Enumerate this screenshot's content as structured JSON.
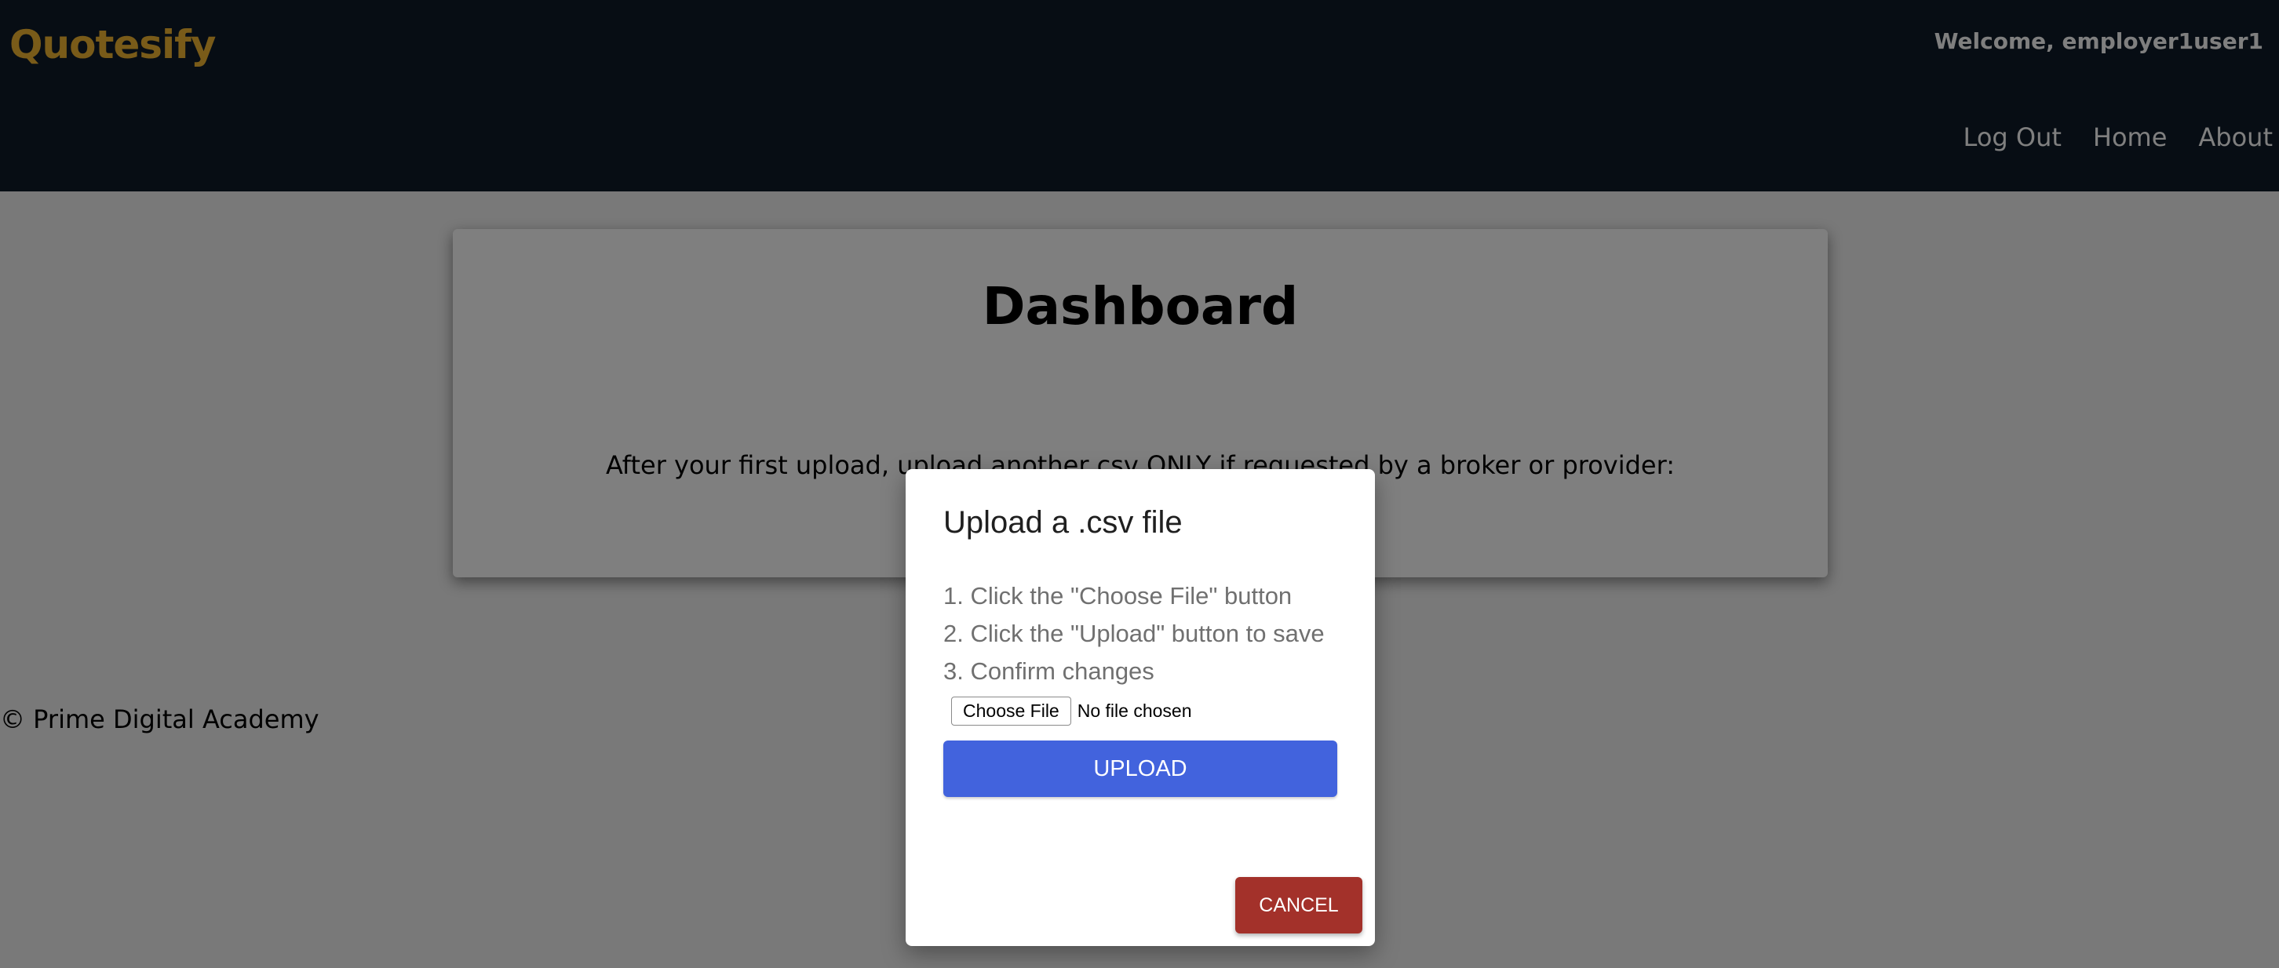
{
  "header": {
    "brand": "Quotesify",
    "welcome": "Welcome, employer1user1",
    "nav": [
      {
        "label": "Log Out"
      },
      {
        "label": "Home"
      },
      {
        "label": "About"
      }
    ]
  },
  "dashboard": {
    "title": "Dashboard",
    "instruction": "After your first upload, upload another csv ONLY if requested by a broker or provider:"
  },
  "footer": {
    "text": "© Prime Digital Academy"
  },
  "modal": {
    "title": "Upload a .csv file",
    "steps": [
      "1. Click the \"Choose File\" button",
      "2. Click the \"Upload\" button to save",
      "3. Confirm changes"
    ],
    "choose_file_label": "Choose File",
    "file_status": "No file chosen",
    "upload_label": "Upload",
    "cancel_label": "Cancel"
  },
  "colors": {
    "nav_bg": "#0f1b28",
    "brand": "#f2b632",
    "upload": "#4263dd",
    "cancel": "#a3312a"
  }
}
